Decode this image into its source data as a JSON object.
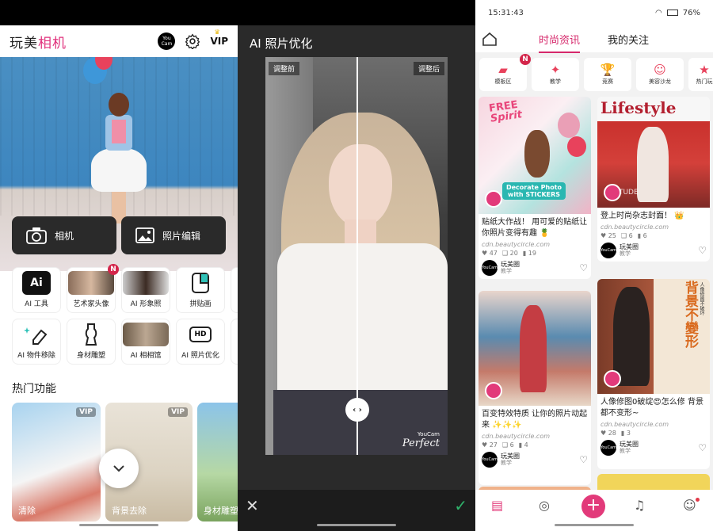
{
  "panel1": {
    "title_part1": "玩美",
    "title_part2": "相机",
    "youcam_logo": "You Cam",
    "vip_label": "VIP",
    "camera_button": "相机",
    "photo_edit_button": "照片编辑",
    "tools": [
      {
        "label": "AI 工具",
        "icon": "ai-icon"
      },
      {
        "label": "艺术家头像",
        "icon": "portrait-thumb",
        "badge": "N"
      },
      {
        "label": "AI 形象照",
        "icon": "portrait-thumb"
      },
      {
        "label": "拼贴画",
        "icon": "collage-icon"
      },
      {
        "label": "AI 物件移除",
        "icon": "eraser-icon"
      },
      {
        "label": "身材雕塑",
        "icon": "body-icon"
      },
      {
        "label": "AI 相相馆",
        "icon": "wolf-thumb"
      },
      {
        "label": "AI 照片优化",
        "icon": "hd-icon",
        "hd_text": "HD"
      }
    ],
    "hot_title": "热门功能",
    "hot_cards": [
      {
        "caption": "清除",
        "vip": "VIP"
      },
      {
        "caption": "背景去除",
        "vip": "VIP"
      },
      {
        "caption": "身材雕塑"
      }
    ],
    "ai_text": "Ai"
  },
  "panel2": {
    "title": "AI 照片优化",
    "before_label": "调整前",
    "after_label": "调整后",
    "handle_label": "‹ ›",
    "watermark_small": "YouCam",
    "watermark": "Perfect"
  },
  "panel3": {
    "time": "15:31:43",
    "battery": "76%",
    "tab_fashion": "时尚资讯",
    "tab_following": "我的关注",
    "chips": [
      {
        "label": "模板区",
        "icon": "template-icon",
        "badge": "N"
      },
      {
        "label": "教学",
        "icon": "wand-icon"
      },
      {
        "label": "竞赛",
        "icon": "trophy-icon"
      },
      {
        "label": "美容沙龙",
        "icon": "salon-icon"
      },
      {
        "label": "热门玩",
        "icon": "star-icon"
      }
    ],
    "cards": [
      {
        "img_text1": "FREE",
        "img_text2": "Spirit",
        "img_text3": "Decorate Photo with STICKERS",
        "title": "贴纸大作战！ 用可爱的贴纸让你照片变得有趣 🍍",
        "src": "cdn.beautycircle.com",
        "likes": "47",
        "comments": "20",
        "saves": "19",
        "author": "玩美圈",
        "author_sub": "教学"
      },
      {
        "img_text1": "Lifestyle",
        "img_text3": "ATTITUDE",
        "title": "登上时尚杂志封面！ 👑",
        "src": "cdn.beautycircle.com",
        "likes": "25",
        "comments": "6",
        "saves": "6",
        "author": "玩美圈",
        "author_sub": "教学"
      },
      {
        "title": "百变特效特质 让你的照片动起来 ✨✨✨",
        "src": "cdn.beautycircle.com",
        "likes": "27",
        "comments": "6",
        "saves": "4",
        "author": "玩美圈",
        "author_sub": "教学"
      },
      {
        "img_text1": "背景不變形",
        "img_text2": "人像修图不破坏",
        "title": "人像修图0破绽😍怎么修 背景都不变形~",
        "src": "cdn.beautycircle.com",
        "likes": "28",
        "comments": "",
        "saves": "3",
        "author": "玩美圈",
        "author_sub": "教学"
      }
    ]
  },
  "colors": {
    "accent": "#e0307b",
    "confirm": "#2fb36b"
  }
}
